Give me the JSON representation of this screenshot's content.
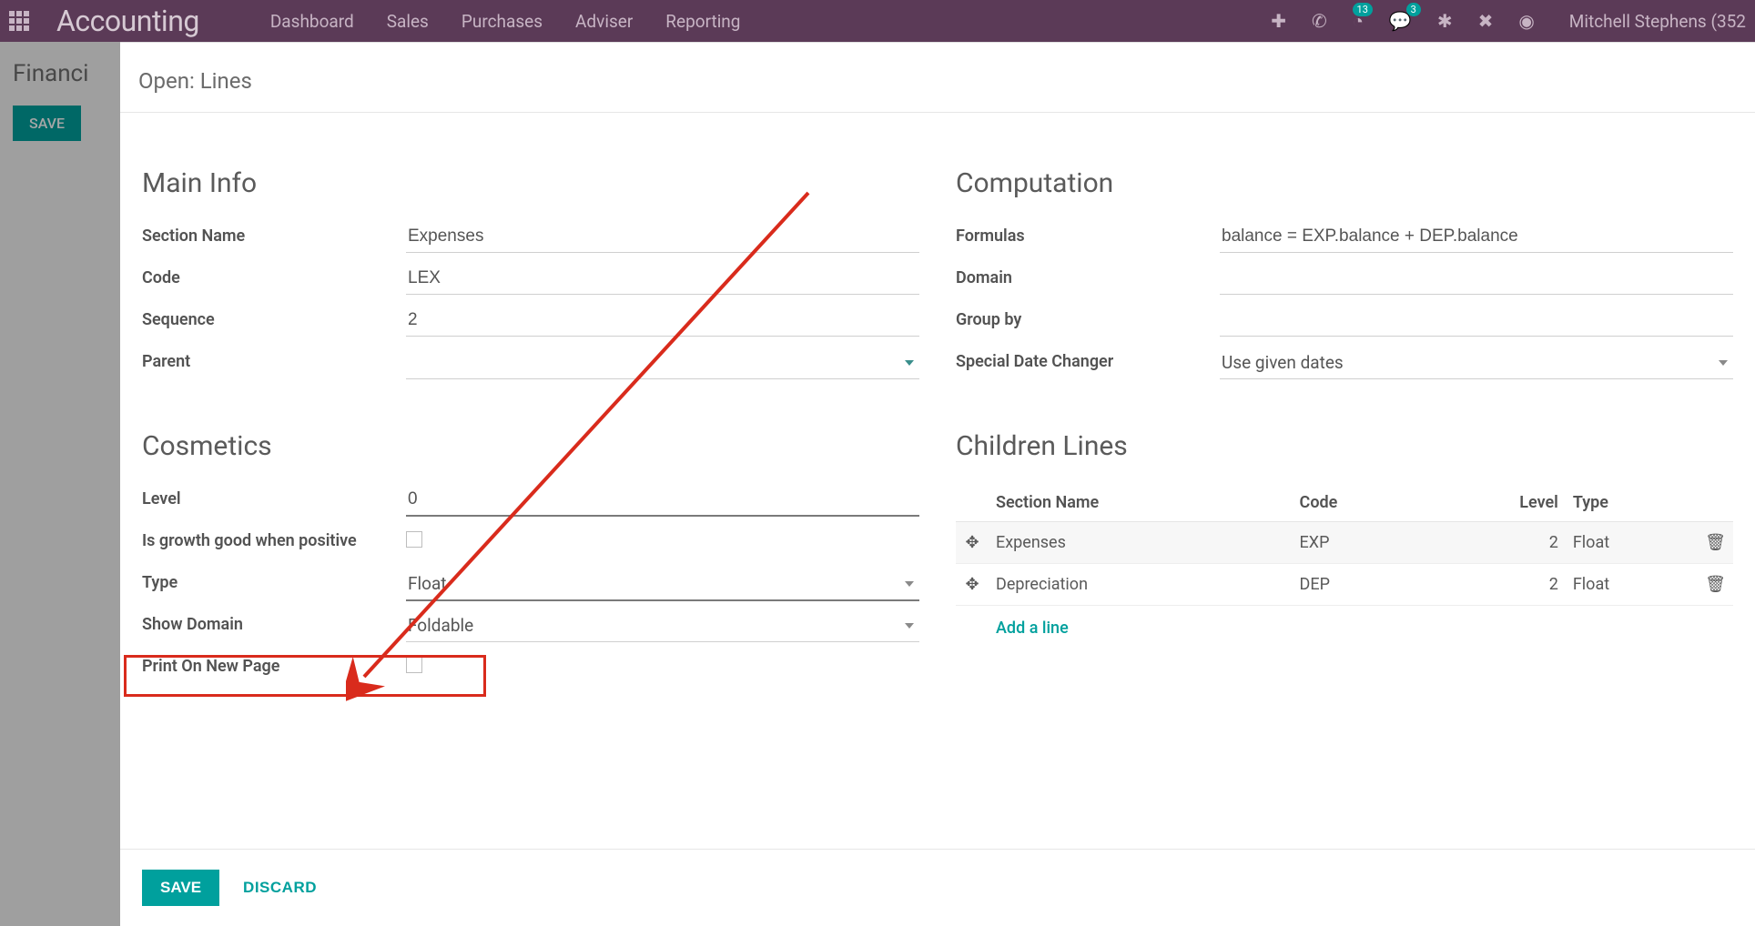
{
  "topbar": {
    "brand": "Accounting",
    "nav": [
      "Dashboard",
      "Sales",
      "Purchases",
      "Adviser",
      "Reporting"
    ],
    "badge_activities": "13",
    "badge_chat": "3",
    "user": "Mitchell Stephens (352"
  },
  "page": {
    "breadcrumb": "Financi",
    "save": "SAVE"
  },
  "modal": {
    "title": "Open: Lines",
    "main_info_title": "Main Info",
    "cosmetics_title": "Cosmetics",
    "computation_title": "Computation",
    "children_title": "Children Lines",
    "labels": {
      "section_name": "Section Name",
      "code": "Code",
      "sequence": "Sequence",
      "parent": "Parent",
      "level": "Level",
      "is_growth": "Is growth good when positive",
      "type": "Type",
      "show_domain": "Show Domain",
      "print_new_page": "Print On New Page",
      "formulas": "Formulas",
      "domain": "Domain",
      "group_by": "Group by",
      "special_date": "Special Date Changer"
    },
    "values": {
      "section_name": "Expenses",
      "code": "LEX",
      "sequence": "2",
      "parent": "",
      "level": "0",
      "type": "Float",
      "show_domain": "Foldable",
      "formulas": "balance = EXP.balance + DEP.balance",
      "domain": "",
      "group_by": "",
      "special_date": "Use given dates"
    },
    "children": {
      "headers": {
        "section": "Section Name",
        "code": "Code",
        "level": "Level",
        "type": "Type"
      },
      "rows": [
        {
          "section": "Expenses",
          "code": "EXP",
          "level": "2",
          "type": "Float"
        },
        {
          "section": "Depreciation",
          "code": "DEP",
          "level": "2",
          "type": "Float"
        }
      ],
      "add_line": "Add a line"
    },
    "footer": {
      "save": "SAVE",
      "discard": "DISCARD"
    }
  }
}
